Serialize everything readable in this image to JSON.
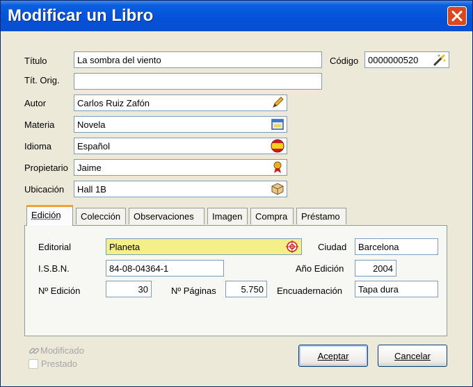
{
  "window": {
    "title": "Modificar un Libro"
  },
  "general": {
    "titulo_label": "Título",
    "titulo_value": "La sombra del viento",
    "tit_orig_label": "Tít. Orig.",
    "tit_orig_value": "",
    "codigo_label": "Código",
    "codigo_value": "0000000520",
    "autor_label": "Autor",
    "autor_value": "Carlos Ruiz Zafón",
    "materia_label": "Materia",
    "materia_value": "Novela",
    "idioma_label": "Idioma",
    "idioma_value": "Español",
    "propietario_label": "Propietario",
    "propietario_value": "Jaime",
    "ubicacion_label": "Ubicación",
    "ubicacion_value": "Hall 1B"
  },
  "tabs": [
    {
      "label": "Edición"
    },
    {
      "label": "Colección"
    },
    {
      "label": "Observaciones"
    },
    {
      "label": "Imagen"
    },
    {
      "label": "Compra"
    },
    {
      "label": "Préstamo"
    }
  ],
  "active_tab": "Edición",
  "edicion": {
    "editorial_label": "Editorial",
    "editorial_value": "Planeta",
    "ciudad_label": "Ciudad",
    "ciudad_value": "Barcelona",
    "isbn_label": "I.S.B.N.",
    "isbn_value": "84-08-04364-1",
    "anio_label": "Año Edición",
    "anio_value": "2004",
    "num_edicion_label": "Nº Edición",
    "num_edicion_value": "30",
    "paginas_label": "Nº Páginas",
    "paginas_value": "5.750",
    "encuadernacion_label": "Encuadernación",
    "encuadernacion_value": "Tapa dura"
  },
  "footer": {
    "modificado_label": "Modificado",
    "prestado_label": "Prestado",
    "prestado_checked": false,
    "accept_label": "Aceptar",
    "cancel_label": "Cancelar"
  },
  "colors": {
    "titlebar": "#0451d8",
    "editorial_highlight": "#f5ef8a",
    "tab_accent": "#f0a234"
  },
  "icons": {
    "close": "close-icon",
    "codigo": "magic-wand-icon",
    "autor": "pencil-icon",
    "materia": "book-category-icon",
    "idioma": "spain-flag-icon",
    "propietario": "ribbon-icon",
    "ubicacion": "box-icon",
    "editorial": "target-icon",
    "modificado": "link-icon"
  }
}
